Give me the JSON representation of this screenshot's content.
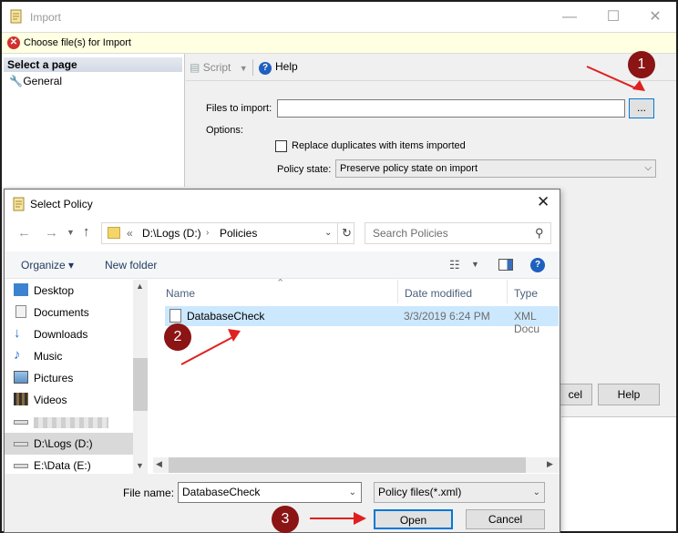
{
  "import_window": {
    "title": "Import",
    "message": "Choose file(s) for Import",
    "select_page": "Select a page",
    "page_general": "General",
    "toolbar": {
      "script": "Script",
      "help": "Help"
    },
    "files_to_import_label": "Files to import:",
    "files_to_import_value": "",
    "browse_label": "...",
    "options_label": "Options:",
    "replace_duplicates_label": "Replace duplicates with items imported",
    "policy_state_label": "Policy state:",
    "policy_state_value": "Preserve policy state on import",
    "cancel_partial": "cel",
    "help_button": "Help"
  },
  "dialog": {
    "title": "Select Policy",
    "breadcrumb": [
      "D:\\Logs (D:)",
      "Policies"
    ],
    "search_placeholder": "Search Policies",
    "organize": "Organize ▾",
    "new_folder": "New folder",
    "nav_items": [
      "Desktop",
      "Documents",
      "Downloads",
      "Music",
      "Pictures",
      "Videos",
      "",
      "D:\\Logs (D:)",
      "E:\\Data (E:)"
    ],
    "columns": {
      "name": "Name",
      "date": "Date modified",
      "type": "Type"
    },
    "files": [
      {
        "name": "DatabaseCheck",
        "date": "3/3/2019 6:24 PM",
        "type": "XML Docu"
      }
    ],
    "file_name_label": "File name:",
    "file_name_value": "DatabaseCheck",
    "filter_value": "Policy files(*.xml)",
    "open_button": "Open",
    "cancel_button": "Cancel"
  },
  "annotations": {
    "step1": "1",
    "step2": "2",
    "step3": "3"
  },
  "colors": {
    "annotation_red": "#e02020",
    "badge": "#8b1414",
    "selection": "#cce8ff"
  }
}
